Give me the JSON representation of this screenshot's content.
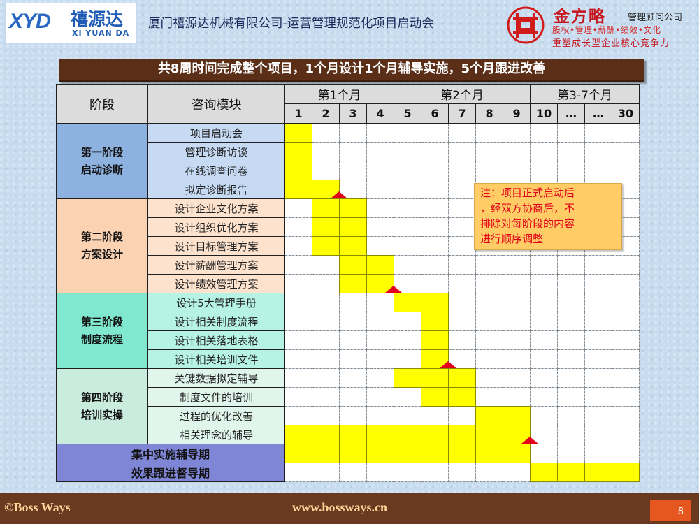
{
  "header": {
    "xyd_logo_letters": "XYD",
    "xyd_logo_cn": "禧源达",
    "xyd_logo_en": "XI YUAN DA",
    "title": "厦门禧源达机械有限公司-运营管理规范化项目启动会",
    "jfl_name": "金方略",
    "jfl_role": "管理顾问公司",
    "jfl_areas": "股权•管理•薪酬•绩效•文化",
    "jfl_slogan": "重塑成长型企业核心竞争力"
  },
  "banner": "共8周时间完成整个项目，1个月设计1个月辅导实施，5个月跟进改善",
  "gantt": {
    "stage_header": "阶段",
    "module_header": "咨询模块",
    "months": [
      {
        "label": "第1个月",
        "span": 4
      },
      {
        "label": "第2个月",
        "span": 5
      },
      {
        "label": "第3-7个月",
        "span": 4
      }
    ],
    "weeks": [
      "1",
      "2",
      "3",
      "4",
      "5",
      "6",
      "7",
      "8",
      "9",
      "10",
      "…",
      "…",
      "30"
    ],
    "stages": [
      {
        "label": "第一阶段\n启动诊断",
        "theme": 1,
        "modules": [
          {
            "label": "项目启动会",
            "fill": [
              0
            ]
          },
          {
            "label": "管理诊断访谈",
            "fill": [
              0
            ]
          },
          {
            "label": "在线调查问卷",
            "fill": [
              0
            ]
          },
          {
            "label": "拟定诊断报告",
            "fill": [
              0,
              1
            ]
          }
        ]
      },
      {
        "label": "第二阶段\n方案设计",
        "theme": 2,
        "modules": [
          {
            "label": "设计企业文化方案",
            "fill": [
              1,
              2
            ]
          },
          {
            "label": "设计组织优化方案",
            "fill": [
              1,
              2
            ]
          },
          {
            "label": "设计目标管理方案",
            "fill": [
              1,
              2
            ]
          },
          {
            "label": "设计薪酬管理方案",
            "fill": [
              2,
              3
            ]
          },
          {
            "label": "设计绩效管理方案",
            "fill": [
              2,
              3
            ]
          }
        ]
      },
      {
        "label": "第三阶段\n制度流程",
        "theme": 3,
        "modules": [
          {
            "label": "设计5大管理手册",
            "fill": [
              4,
              5
            ]
          },
          {
            "label": "设计相关制度流程",
            "fill": [
              5
            ]
          },
          {
            "label": "设计相关落地表格",
            "fill": [
              5
            ]
          },
          {
            "label": "设计相关培训文件",
            "fill": [
              5
            ]
          }
        ]
      },
      {
        "label": "第四阶段\n培训实操",
        "theme": 4,
        "modules": [
          {
            "label": "关键数据拟定辅导",
            "fill": [
              4,
              5,
              6
            ]
          },
          {
            "label": "制度文件的培训",
            "fill": [
              5,
              6
            ]
          },
          {
            "label": "过程的优化改善",
            "fill": [
              7,
              8
            ]
          },
          {
            "label": "相关理念的辅导",
            "fill": [
              0,
              1,
              2,
              3,
              4,
              5,
              6,
              7,
              8
            ]
          }
        ]
      }
    ],
    "periods": [
      {
        "label": "集中实施辅导期",
        "fill": [
          0,
          1,
          2,
          3,
          4,
          5,
          6,
          7,
          8
        ]
      },
      {
        "label": "效果跟进督导期",
        "fill": [
          9,
          10,
          11,
          12
        ]
      }
    ],
    "milestones": [
      {
        "after_row": 3,
        "week": 1
      },
      {
        "after_row": 8,
        "week": 3
      },
      {
        "after_row": 12,
        "week": 5
      },
      {
        "after_row": 16,
        "week": 8
      }
    ]
  },
  "note": [
    "注：项目正式启动后",
    "，经双方协商后，不",
    "排除对每阶段的内容",
    "进行顺序调整"
  ],
  "footer": {
    "copyright": "©Boss Ways",
    "url": "www.bossways.cn",
    "page": "8"
  },
  "colors": {
    "fill": "#ffff00",
    "milestone": "#e4001b",
    "banner": "#5b2f17",
    "period": "#7f86d6"
  }
}
